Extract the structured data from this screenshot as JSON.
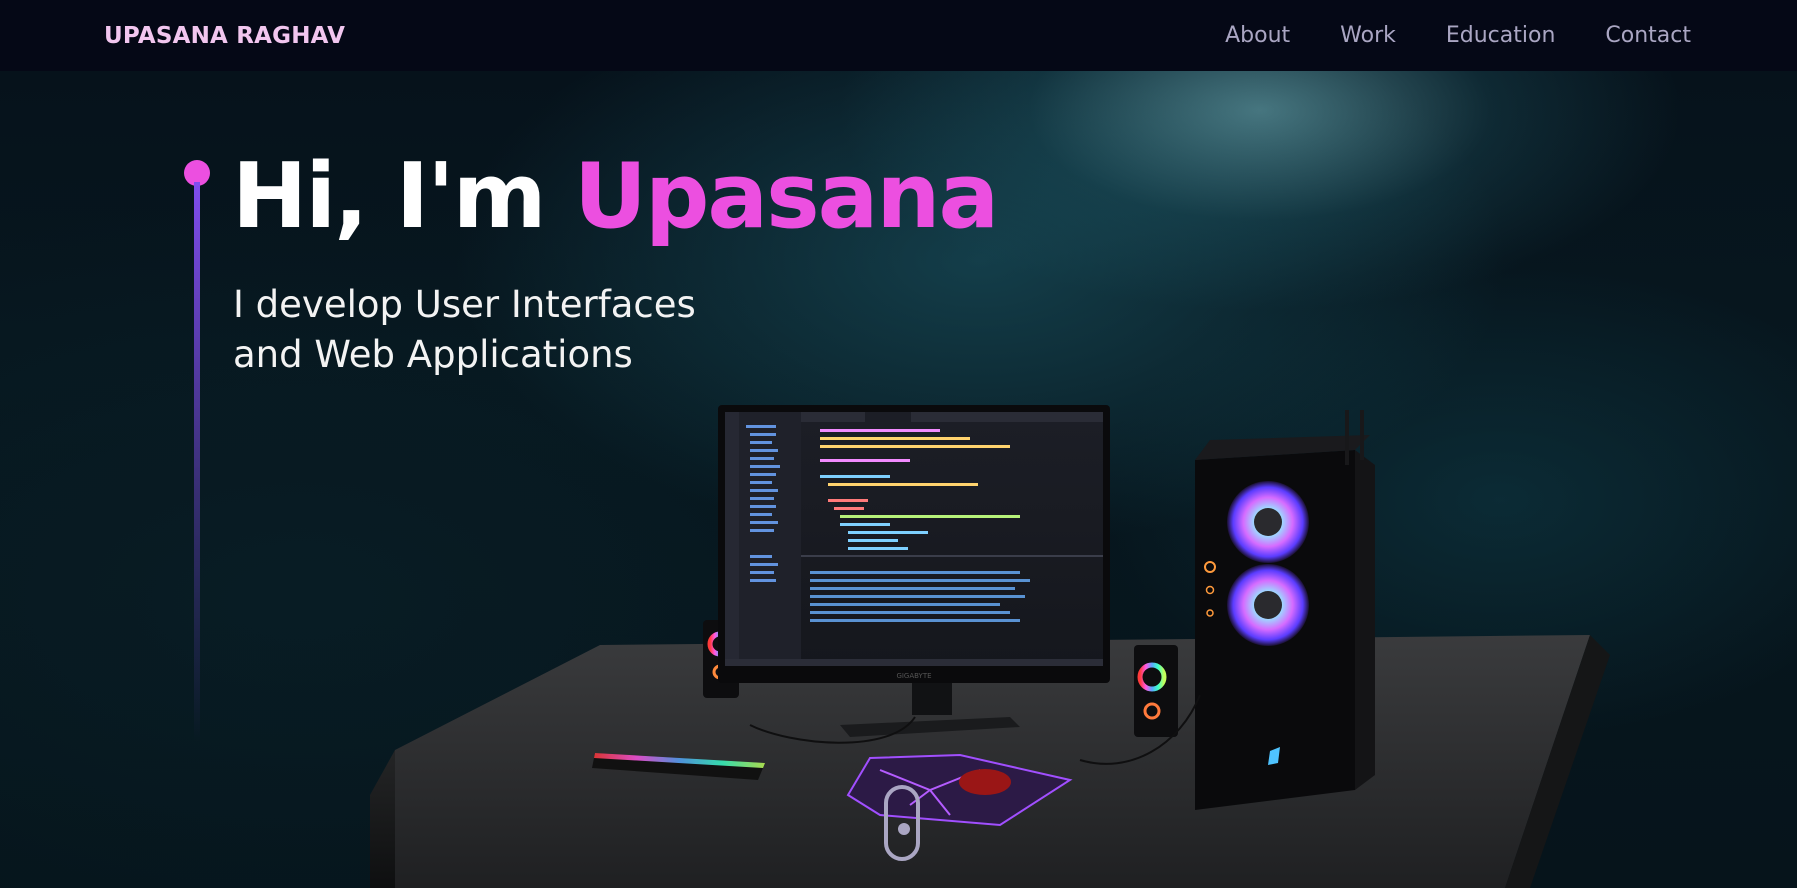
{
  "navbar": {
    "logo": "UPASANA RAGHAV",
    "links": [
      "About",
      "Work",
      "Education",
      "Contact"
    ]
  },
  "hero": {
    "greeting": "Hi, I'm ",
    "name": "Upasana",
    "subtitle_line1": "I develop User Interfaces",
    "subtitle_line2": "and Web Applications"
  },
  "scene": {
    "monitor_brand": "GIGABYTE"
  },
  "colors": {
    "background": "#050816",
    "accent_pink": "#ec4fe0",
    "accent_purple": "#804dee",
    "nav_text": "#aaa6c3",
    "logo_text": "#f2c6ef"
  }
}
